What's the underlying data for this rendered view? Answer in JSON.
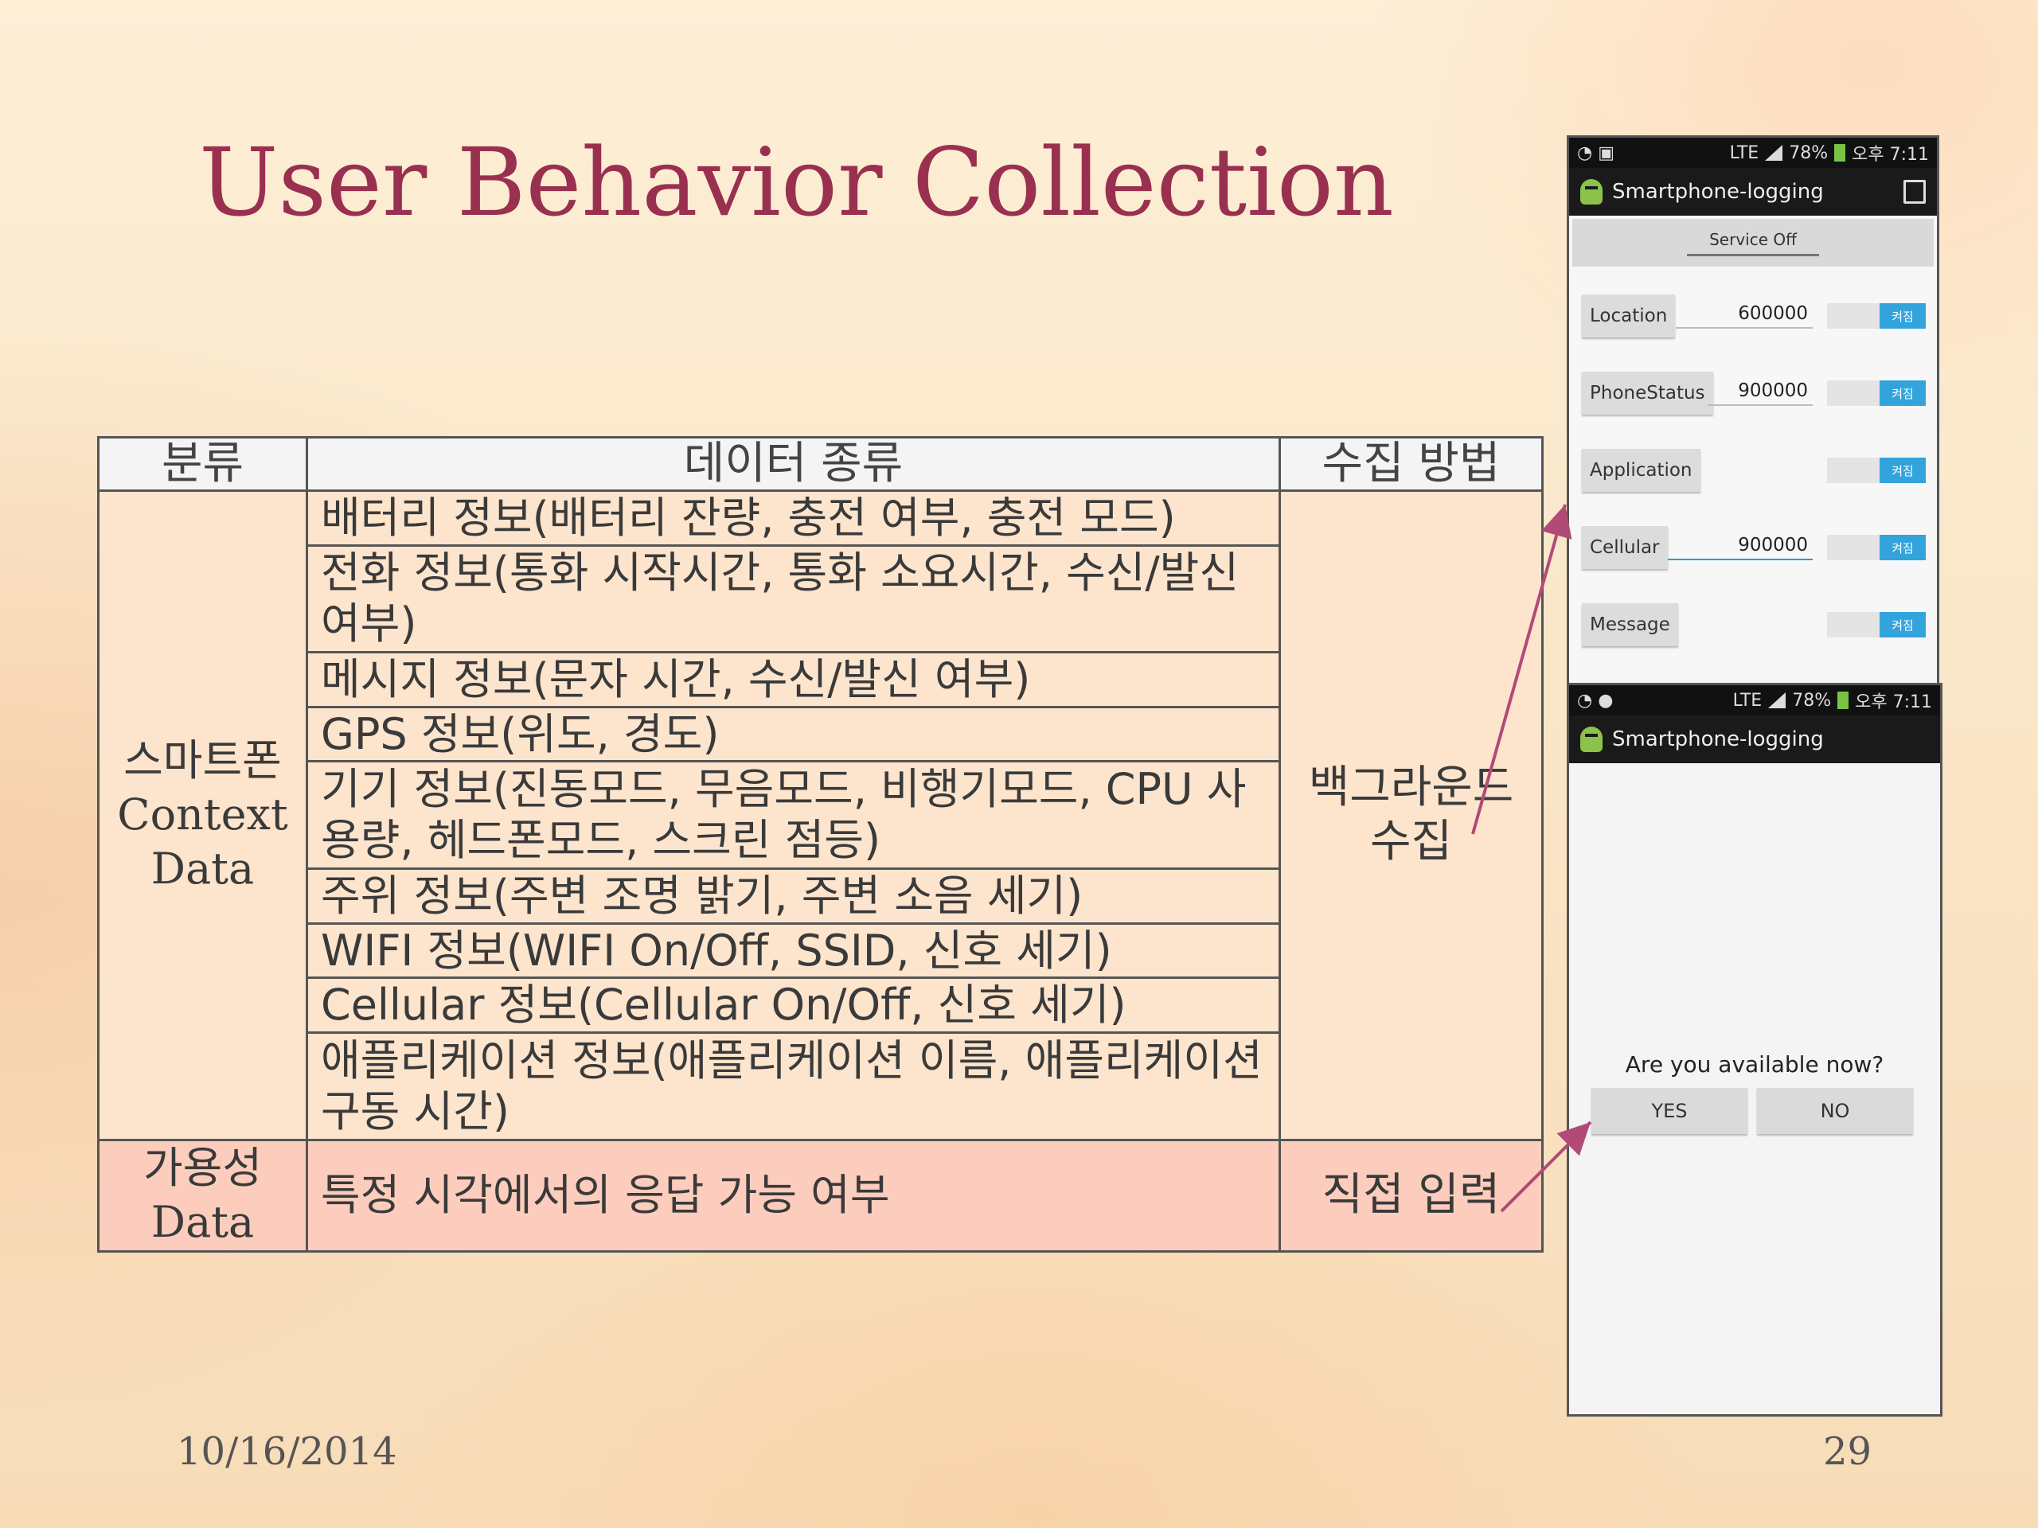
{
  "slide": {
    "title": "User Behavior Collection",
    "date": "10/16/2014",
    "page_number": "29"
  },
  "table": {
    "headers": [
      "분류",
      "데이터 종류",
      "수집 방법"
    ],
    "smartphone": {
      "category_ko": "스마트폰",
      "category_en_1": "Context",
      "category_en_2": "Data",
      "items": [
        "배터리 정보(배터리 잔량, 충전 여부, 충전 모드)",
        "전화 정보(통화 시작시간, 통화 소요시간, 수신/발신 여부)",
        "메시지 정보(문자 시간, 수신/발신 여부)",
        "GPS 정보(위도, 경도)",
        "기기 정보(진동모드, 무음모드, 비행기모드, CPU 사용량, 헤드폰모드, 스크린 점등)",
        "주위 정보(주변 조명 밝기, 주변 소음 세기)",
        "WIFI 정보(WIFI On/Off, SSID, 신호 세기)",
        "Cellular 정보(Cellular On/Off, 신호 세기)",
        "애플리케이션 정보(애플리케이션 이름, 애플리케이션 구동 시간)"
      ],
      "method_1": "백그라운드",
      "method_2": "수집"
    },
    "availability": {
      "category_ko": "가용성",
      "category_en": "Data",
      "item": "특정 시각에서의 응답 가능 여부",
      "method": "직접 입력"
    }
  },
  "phone1": {
    "status_time": "오후 7:11",
    "status_battery": "78%",
    "status_network": "LTE",
    "app_title": "Smartphone-logging",
    "service_label": "Service Off",
    "toggle_label": "켜짐",
    "rows": [
      {
        "label": "Location",
        "value": "600000"
      },
      {
        "label": "PhoneStatus",
        "value": "900000"
      },
      {
        "label": "Application",
        "value": ""
      },
      {
        "label": "Cellular",
        "value": "900000"
      },
      {
        "label": "Message",
        "value": ""
      }
    ]
  },
  "phone2": {
    "status_time": "오후 7:11",
    "status_battery": "78%",
    "status_network": "LTE",
    "app_title": "Smartphone-logging",
    "prompt": "Are you available now?",
    "yes_label": "YES",
    "no_label": "NO"
  },
  "colors": {
    "title": "#9a3050",
    "table_body": "#fde5cd",
    "availability_row": "#fccdbd",
    "arrow": "#b24a78",
    "toggle_on": "#33a3dc"
  }
}
